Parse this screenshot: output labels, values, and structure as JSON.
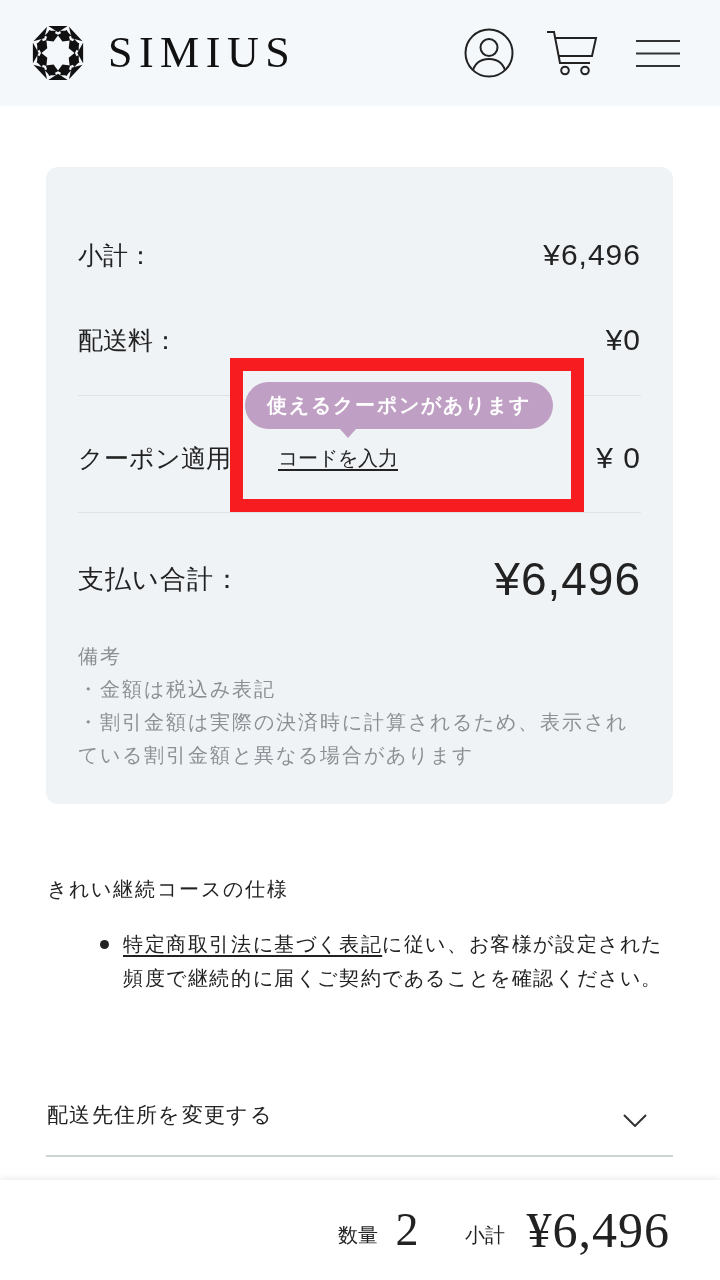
{
  "header": {
    "logo_text": "SIMIUS"
  },
  "summary": {
    "rows": [
      {
        "kind": "line",
        "label": "小計：",
        "value": "¥6,496"
      },
      {
        "kind": "line",
        "label": "配送料：",
        "value": "¥0"
      },
      {
        "kind": "coupon",
        "label": "クーポン適用",
        "value": "¥ 0"
      },
      {
        "kind": "total",
        "label": "支払い合計：",
        "value": "¥6,496"
      }
    ],
    "notes": {
      "title": "備考",
      "items": [
        "・金額は税込み表記",
        "・割引金額は実際の決済時に計算されるため、表示されている割引金額と異なる場合があります"
      ]
    }
  },
  "highlight": {
    "tooltip": "使えるクーポンがあります",
    "link": "コードを入力"
  },
  "course": {
    "title": "きれい継続コースの仕様",
    "bullets": [
      {
        "link": "特定商取引法に基づく表記",
        "text": "に従い、お客様が設定された頻度で継続的に届くご契約であることを確認ください。"
      }
    ]
  },
  "accordion": {
    "label": "配送先住所を変更する",
    "expanded": false
  },
  "bottom_bar": {
    "quantity_label": "数量",
    "quantity": "2",
    "subtotal_label": "小計",
    "subtotal": "¥6,496"
  }
}
